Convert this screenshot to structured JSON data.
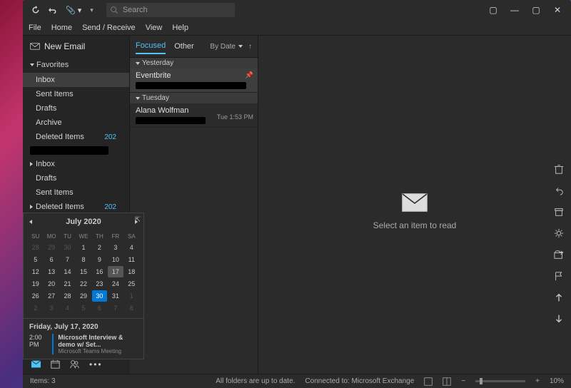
{
  "titlebar": {
    "search_placeholder": "Search"
  },
  "menubar": [
    "File",
    "Home",
    "Send / Receive",
    "View",
    "Help"
  ],
  "new_email_label": "New Email",
  "favorites": {
    "header": "Favorites",
    "items": [
      {
        "label": "Inbox",
        "count": null,
        "selected": true
      },
      {
        "label": "Sent Items",
        "count": null
      },
      {
        "label": "Drafts",
        "count": null
      },
      {
        "label": "Archive",
        "count": null
      },
      {
        "label": "Deleted Items",
        "count": "202"
      }
    ]
  },
  "account_folders": {
    "items": [
      {
        "label": "Inbox",
        "count": null,
        "expandable": true
      },
      {
        "label": "Drafts",
        "count": null
      },
      {
        "label": "Sent Items",
        "count": null
      },
      {
        "label": "Deleted Items",
        "count": "202",
        "expandable": true
      }
    ]
  },
  "message_list": {
    "tabs": [
      {
        "label": "Focused",
        "active": true
      },
      {
        "label": "Other",
        "active": false
      }
    ],
    "sort_label": "By Date",
    "groups": [
      {
        "label": "Yesterday",
        "messages": [
          {
            "sender": "Eventbrite",
            "selected": true,
            "pinned": true
          }
        ]
      },
      {
        "label": "Tuesday",
        "messages": [
          {
            "sender": "Alana Wolfman",
            "time": "Tue 1:53 PM"
          }
        ]
      }
    ]
  },
  "reading_pane": {
    "empty_text": "Select an item to read"
  },
  "calendar": {
    "title": "July 2020",
    "day_names": [
      "SU",
      "MO",
      "TU",
      "WE",
      "TH",
      "FR",
      "SA"
    ],
    "rows": [
      [
        {
          "d": "28",
          "o": 1
        },
        {
          "d": "29",
          "o": 1
        },
        {
          "d": "30",
          "o": 1
        },
        {
          "d": "1"
        },
        {
          "d": "2"
        },
        {
          "d": "3"
        },
        {
          "d": "4"
        }
      ],
      [
        {
          "d": "5"
        },
        {
          "d": "6"
        },
        {
          "d": "7"
        },
        {
          "d": "8"
        },
        {
          "d": "9"
        },
        {
          "d": "10"
        },
        {
          "d": "11"
        }
      ],
      [
        {
          "d": "12"
        },
        {
          "d": "13"
        },
        {
          "d": "14"
        },
        {
          "d": "15"
        },
        {
          "d": "16"
        },
        {
          "d": "17",
          "sel": 1
        },
        {
          "d": "18"
        }
      ],
      [
        {
          "d": "19"
        },
        {
          "d": "20"
        },
        {
          "d": "21"
        },
        {
          "d": "22"
        },
        {
          "d": "23"
        },
        {
          "d": "24"
        },
        {
          "d": "25"
        }
      ],
      [
        {
          "d": "26"
        },
        {
          "d": "27"
        },
        {
          "d": "28"
        },
        {
          "d": "29"
        },
        {
          "d": "30",
          "today": 1
        },
        {
          "d": "31"
        },
        {
          "d": "1",
          "o": 1
        }
      ],
      [
        {
          "d": "2",
          "o": 1
        },
        {
          "d": "3",
          "o": 1
        },
        {
          "d": "4",
          "o": 1
        },
        {
          "d": "5",
          "o": 1
        },
        {
          "d": "6",
          "o": 1
        },
        {
          "d": "7",
          "o": 1
        },
        {
          "d": "8",
          "o": 1
        }
      ]
    ],
    "event_date": "Friday, July 17, 2020",
    "event_time": "2:00 PM",
    "event_title": "Microsoft Interview & demo w/ Set...",
    "event_sub": "Microsoft Teams Meeting"
  },
  "statusbar": {
    "items_label": "Items: 3",
    "sync_status": "All folders are up to date.",
    "connection": "Connected to: Microsoft Exchange",
    "zoom": "10%"
  }
}
